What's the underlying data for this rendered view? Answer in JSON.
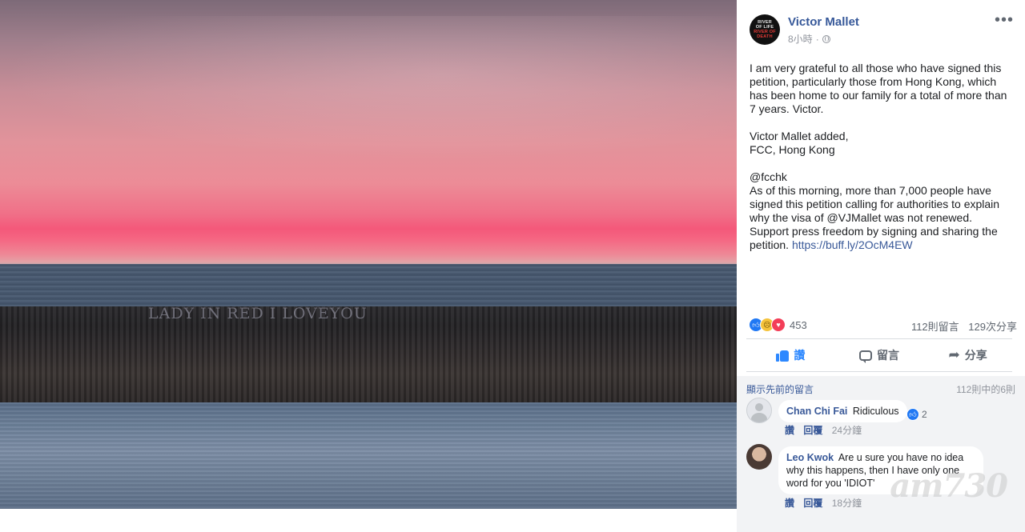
{
  "photo": {
    "wall_text": "LADY IN RED  I LOVEYOU"
  },
  "post": {
    "author": "Victor Mallet",
    "avatar_lines": [
      "RIVER",
      "OF LIFE",
      "RIVER OF",
      "DEATH"
    ],
    "time": "8小時",
    "body": {
      "p1": "I am very grateful to all those who have signed this petition, particularly those from Hong Kong, which has been home to our family for a total of more than 7 years. Victor.",
      "p2_line1": "Victor Mallet added,",
      "p2_line2": "FCC, Hong Kong",
      "p3_line1": "@fcchk",
      "p3_text": "As of this morning, more than 7,000 people have signed this petition calling for authorities to explain why the visa of @VJMallet was not renewed. Support press freedom by signing and sharing the petition.",
      "link": "https://buff.ly/2OcM4EW"
    },
    "reaction_count": "453",
    "comment_count": "112則留言",
    "share_count": "129次分享",
    "actions": {
      "like": "讚",
      "comment": "留言",
      "share": "分享"
    }
  },
  "comments": {
    "previous_label": "顯示先前的留言",
    "shown_of_total": "112則中的6則",
    "items": [
      {
        "name": "Chan Chi Fai",
        "text": "Ridiculous",
        "reactions": "2",
        "like": "讚",
        "reply": "回覆",
        "time": "24分鐘"
      },
      {
        "name": "Leo Kwok",
        "text": "Are u sure you have no idea why this happens, then I have only one word for you 'IDIOT'",
        "like": "讚",
        "reply": "回覆",
        "time": "18分鐘"
      }
    ]
  },
  "watermark": "am730"
}
